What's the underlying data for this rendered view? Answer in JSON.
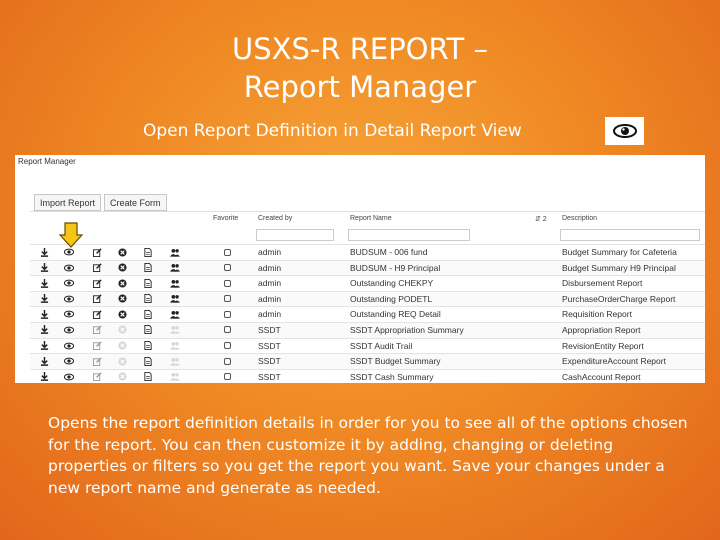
{
  "slide": {
    "title_line1": "USXS-R REPORT –",
    "title_line2": "Report Manager",
    "subtitle": "Open Report Definition in Detail Report View",
    "body": "Opens the report definition details in order for you to see all of the options chosen for the report.  You can then customize it by adding, changing or deleting properties or filters so you get the report you want.  Save your changes under a new report name and generate as needed."
  },
  "report_manager": {
    "title": "Report Manager",
    "buttons": {
      "import": "Import Report",
      "create": "Create Form"
    },
    "columns": {
      "favorite": "Favorite",
      "created_by": "Created by",
      "report_name": "Report Name",
      "sort_indicator": "⇵ 2",
      "description": "Description"
    },
    "rows": [
      {
        "created_by": "admin",
        "report_name": "BUDSUM - 006 fund",
        "description": "Budget Summary for Cafeteria",
        "active": true
      },
      {
        "created_by": "admin",
        "report_name": "BUDSUM - H9 Principal",
        "description": "Budget Summary H9 Principal",
        "active": true
      },
      {
        "created_by": "admin",
        "report_name": "Outstanding CHEKPY",
        "description": "Disbursement Report",
        "active": true
      },
      {
        "created_by": "admin",
        "report_name": "Outstanding PODETL",
        "description": "PurchaseOrderCharge Report",
        "active": true
      },
      {
        "created_by": "admin",
        "report_name": "Outstanding REQ Detail",
        "description": "Requisition Report",
        "active": true
      },
      {
        "created_by": "SSDT",
        "report_name": "SSDT Appropriation Summary",
        "description": "Appropriation Report",
        "active": false
      },
      {
        "created_by": "SSDT",
        "report_name": "SSDT Audit Trail",
        "description": "RevisionEntity Report",
        "active": false
      },
      {
        "created_by": "SSDT",
        "report_name": "SSDT Budget Summary",
        "description": "ExpenditureAccount Report",
        "active": false
      },
      {
        "created_by": "SSDT",
        "report_name": "SSDT Cash Summary",
        "description": "CashAccount Report",
        "active": false
      }
    ]
  },
  "icons": {
    "download": "download-icon",
    "view": "eye-icon",
    "edit": "edit-icon",
    "delete": "delete-icon",
    "document": "document-icon",
    "share": "users-icon"
  },
  "colors": {
    "background": "#f08a24",
    "arrow": "#f5c518"
  }
}
